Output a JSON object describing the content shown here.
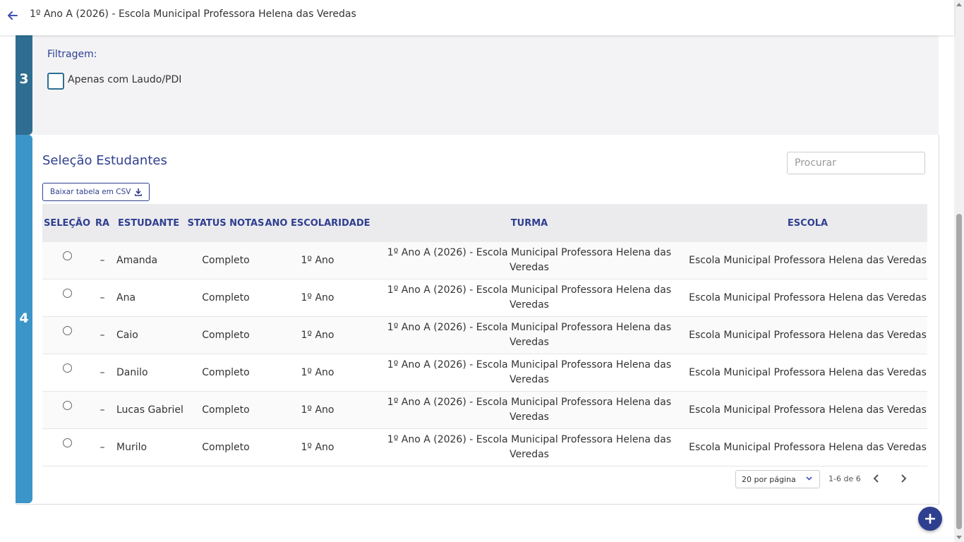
{
  "header": {
    "title": "1º Ano A (2026) - Escola Municipal Professora Helena das Veredas",
    "back_icon": "arrow-left-icon"
  },
  "step3": {
    "number": "3",
    "filter_label": "Filtragem:",
    "checkbox_label": "Apenas com Laudo/PDI",
    "checkbox_checked": false
  },
  "step4": {
    "number": "4",
    "title": "Seleção Estudantes",
    "search_placeholder": "Procurar",
    "csv_button": "Baixar tabela em CSV",
    "columns": [
      "SELEÇÃO",
      "RA",
      "ESTUDANTE",
      "STATUS NOTAS",
      "ANO ESCOLARIDADE",
      "TURMA",
      "ESCOLA"
    ],
    "rows": [
      {
        "ra": "–",
        "estudante": "Amanda",
        "status": "Completo",
        "ano": "1º Ano",
        "turma": "1º Ano A (2026) - Escola Municipal Professora Helena das Veredas",
        "escola": "Escola Municipal Professora Helena das Veredas"
      },
      {
        "ra": "–",
        "estudante": "Ana",
        "status": "Completo",
        "ano": "1º Ano",
        "turma": "1º Ano A (2026) - Escola Municipal Professora Helena das Veredas",
        "escola": "Escola Municipal Professora Helena das Veredas"
      },
      {
        "ra": "–",
        "estudante": "Caio",
        "status": "Completo",
        "ano": "1º Ano",
        "turma": "1º Ano A (2026) - Escola Municipal Professora Helena das Veredas",
        "escola": "Escola Municipal Professora Helena das Veredas"
      },
      {
        "ra": "–",
        "estudante": "Danilo",
        "status": "Completo",
        "ano": "1º Ano",
        "turma": "1º Ano A (2026) - Escola Municipal Professora Helena das Veredas",
        "escola": "Escola Municipal Professora Helena das Veredas"
      },
      {
        "ra": "–",
        "estudante": "Lucas Gabriel",
        "status": "Completo",
        "ano": "1º Ano",
        "turma": "1º Ano A (2026) - Escola Municipal Professora Helena das Veredas",
        "escola": "Escola Municipal Professora Helena das Veredas"
      },
      {
        "ra": "–",
        "estudante": "Murilo",
        "status": "Completo",
        "ano": "1º Ano",
        "turma": "1º Ano A (2026) - Escola Municipal Professora Helena das Veredas",
        "escola": "Escola Municipal Professora Helena das Veredas"
      }
    ],
    "pagination": {
      "per_page": "20 por página",
      "range": "1-6 de 6"
    }
  },
  "colors": {
    "step3_rail": "#2f6e92",
    "step4_rail": "#3c95c8",
    "primary": "#2f3f8f"
  },
  "fab_icon": "plus-icon"
}
